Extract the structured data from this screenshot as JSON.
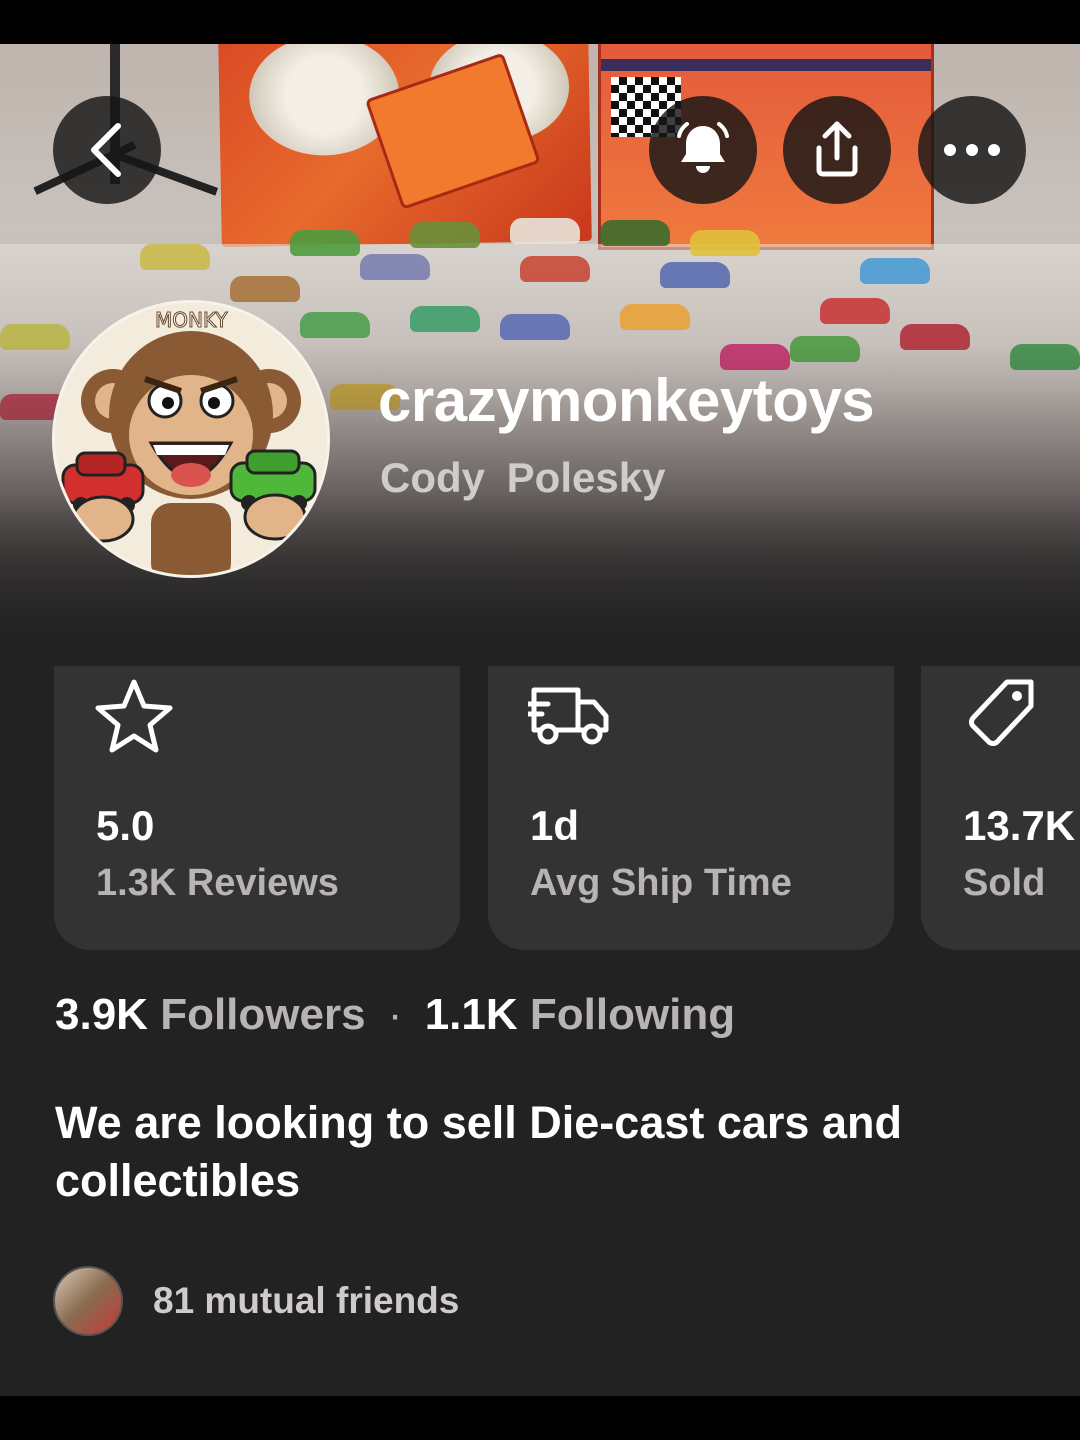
{
  "header": {
    "back_icon": "chevron-left-icon",
    "notify_icon": "bell-icon",
    "share_icon": "share-icon",
    "more_icon": "more-dots-icon"
  },
  "profile": {
    "username": "crazymonkeytoys",
    "display_name": "Cody  Polesky",
    "avatar_text": "MONKY"
  },
  "stats": [
    {
      "icon": "star-icon",
      "value": "5.0",
      "label": "1.3K Reviews"
    },
    {
      "icon": "truck-icon",
      "value": "1d",
      "label": "Avg Ship Time"
    },
    {
      "icon": "tag-icon",
      "value": "13.7K",
      "label": "Sold"
    }
  ],
  "follow": {
    "followers_count": "3.9K",
    "followers_label": "Followers",
    "separator": "·",
    "following_count": "1.1K",
    "following_label": "Following"
  },
  "bio": "We are looking to sell Die-cast cars and collectibles",
  "mutual": {
    "text": "81 mutual friends"
  },
  "colors": {
    "background": "#222222",
    "card": "#333333",
    "text_primary": "#ffffff",
    "text_secondary": "#b7b4b3"
  }
}
